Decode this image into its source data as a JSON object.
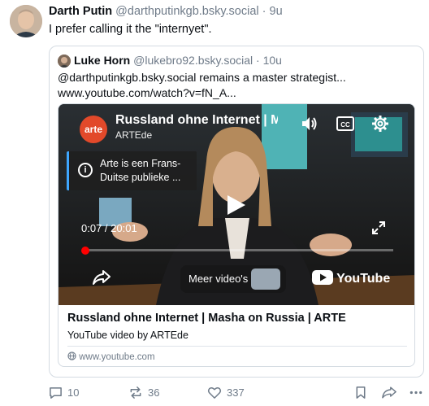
{
  "post": {
    "author_name": "Darth Putin",
    "author_handle": "@darthputinkgb.bsky.social",
    "separator": "·",
    "time": "9u",
    "text": "I prefer calling it the \"internyet\"."
  },
  "quote": {
    "author_name": "Luke Horn",
    "author_handle": "@lukebro92.bsky.social",
    "separator": "·",
    "time": "10u",
    "text": "@darthputinkgb.bsky.social remains a master strategist... www.youtube.com/watch?v=fN_A..."
  },
  "embed": {
    "video": {
      "logo_text": "arte",
      "title": "Russland ohne Internet | M",
      "channel": "ARTEde",
      "info_card": "Arte is een Frans-Duitse publieke ...",
      "time": "0:07 / 20:01",
      "progress": 0.0058,
      "more_videos": "Meer video's",
      "youtube_logo_text": "YouTube"
    },
    "title": "Russland ohne Internet | Masha on Russia | ARTE",
    "subtitle": "YouTube video by ARTEde",
    "domain": "www.youtube.com"
  },
  "actions": {
    "replies": "10",
    "reposts": "36",
    "likes": "337"
  },
  "colors": {
    "accent": "#1083fe",
    "muted": "#6f7b89",
    "yt_red": "#ff0000",
    "arte_orange": "#e2492a"
  }
}
